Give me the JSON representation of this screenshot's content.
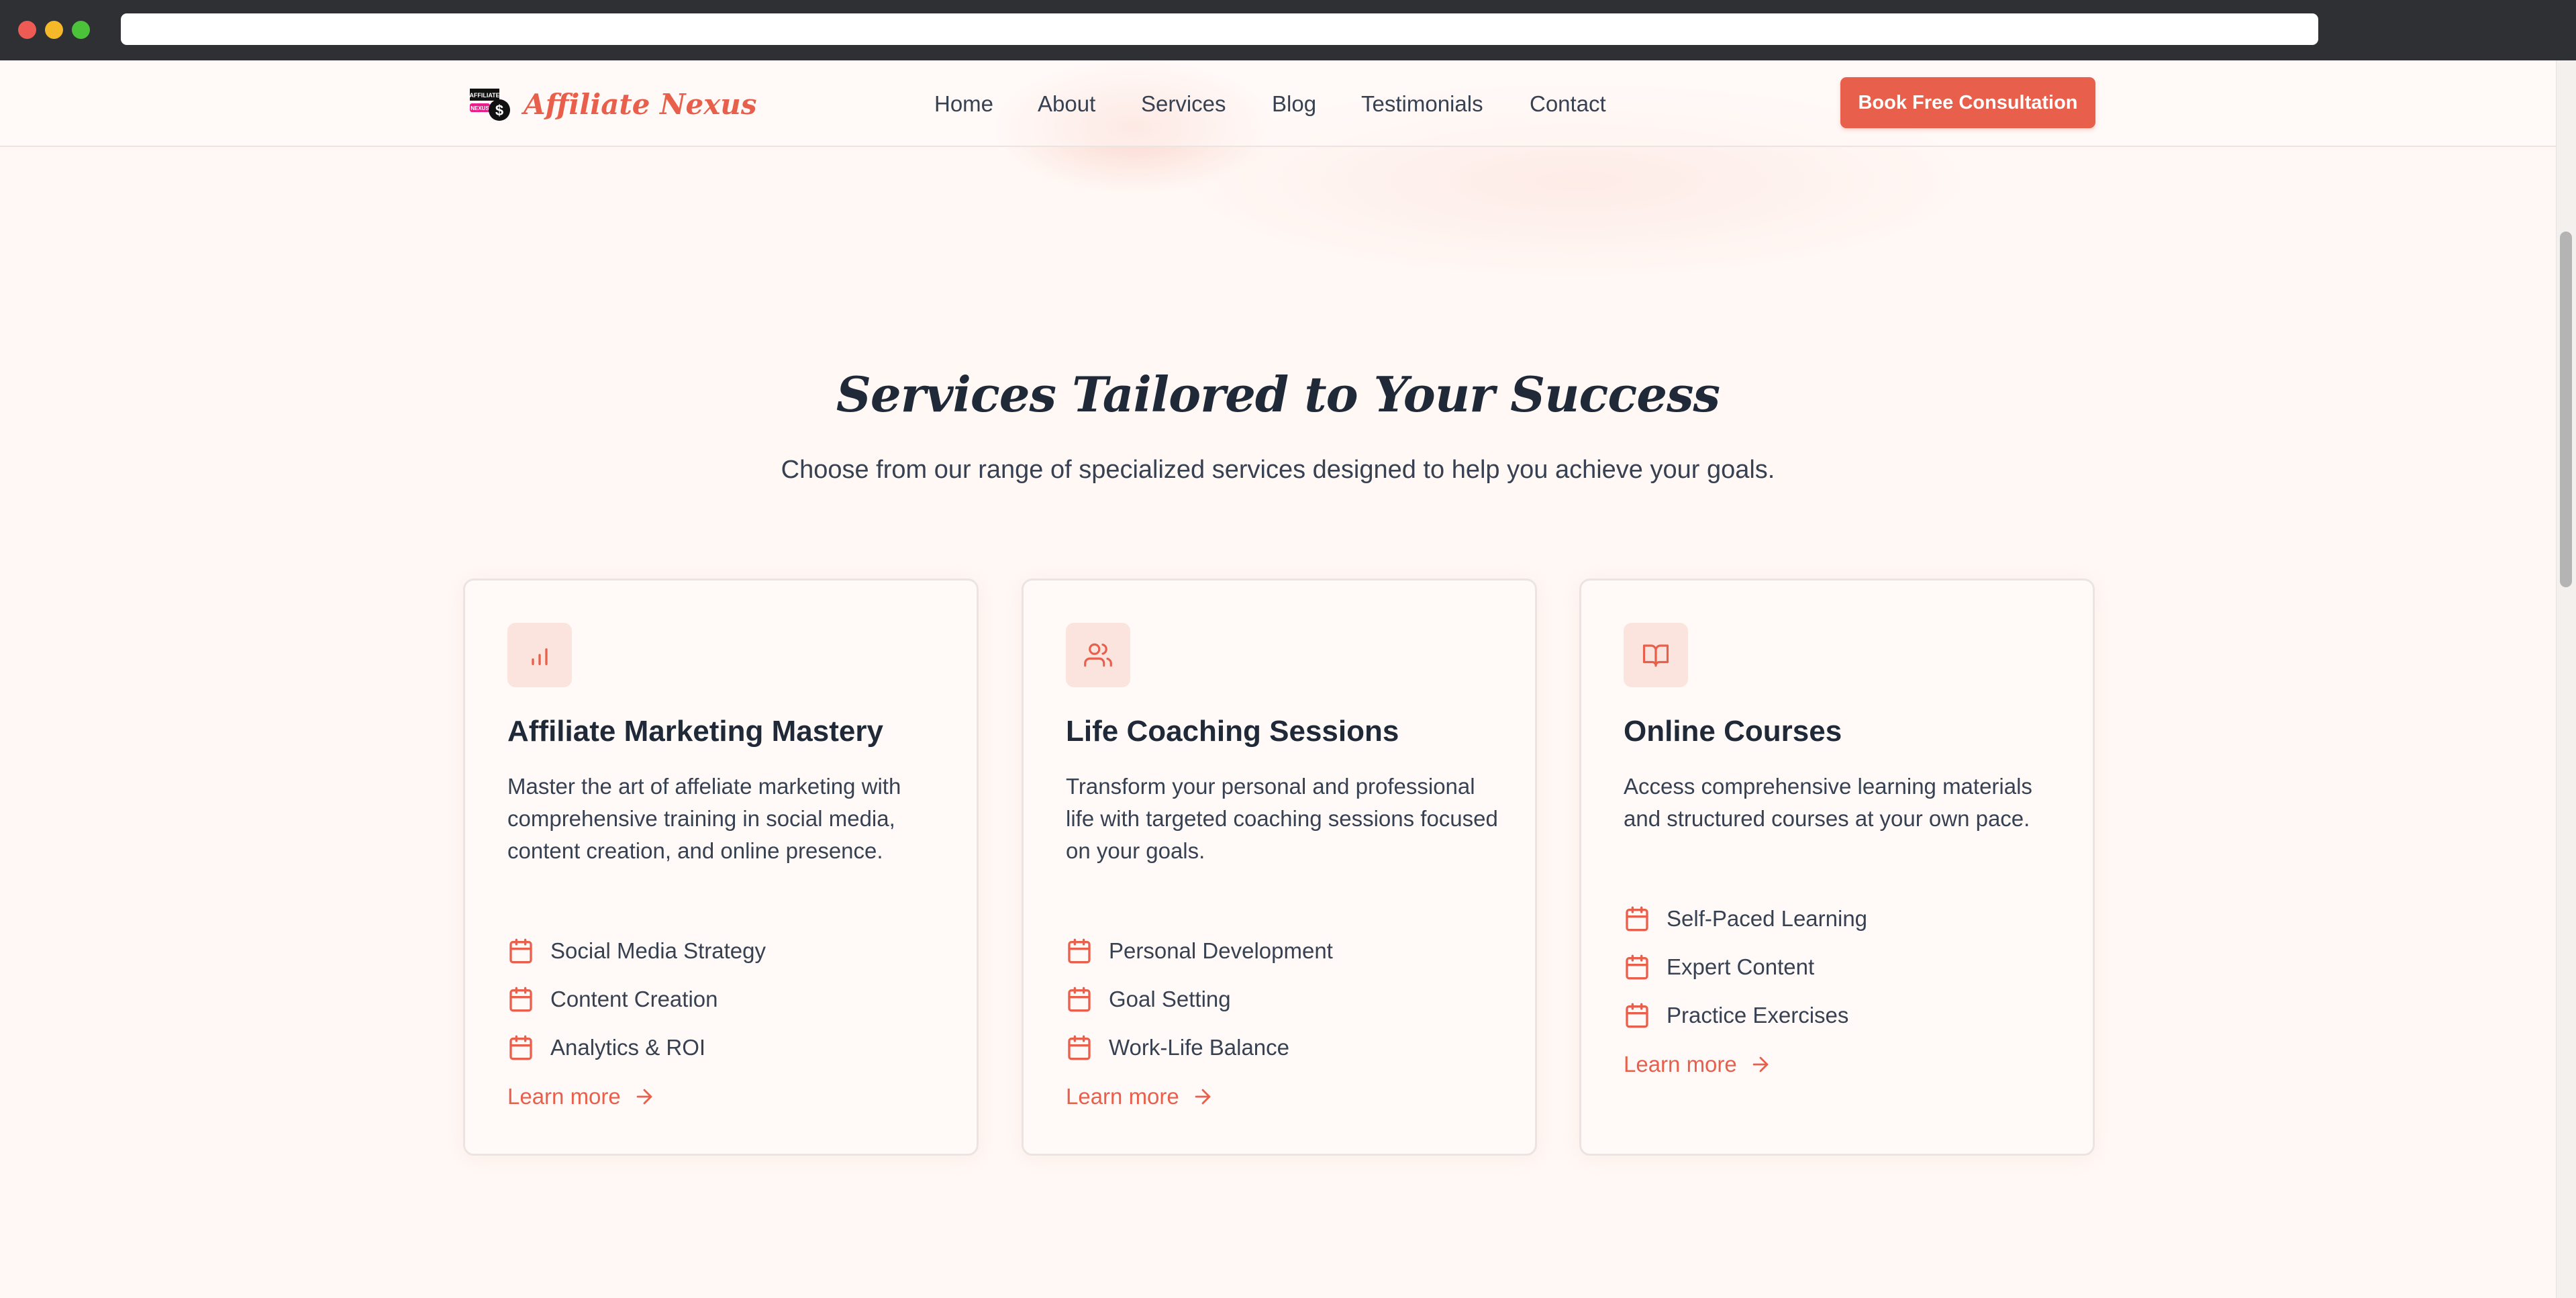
{
  "brand": {
    "name": "Affiliate Nexus",
    "logo_text": "AFFILIATE",
    "logo_badge": "NEXUS",
    "accent_color": "#e8604c"
  },
  "nav": {
    "items": [
      {
        "label": "Home"
      },
      {
        "label": "About"
      },
      {
        "label": "Services"
      },
      {
        "label": "Blog"
      },
      {
        "label": "Testimonials"
      },
      {
        "label": "Contact"
      }
    ],
    "cta_label": "Book Free Consultation"
  },
  "services": {
    "title": "Services Tailored to Your Success",
    "subtitle": "Choose from our range of specialized services designed to help you achieve your goals.",
    "cards": [
      {
        "icon": "bar-chart-icon",
        "title": "Affiliate Marketing Mastery",
        "description": "Master the art of affeliate marketing with comprehensive training in social media, content creation, and online presence.",
        "features": [
          "Social Media Strategy",
          "Content Creation",
          "Analytics & ROI"
        ],
        "link_label": "Learn more"
      },
      {
        "icon": "users-icon",
        "title": "Life Coaching Sessions",
        "description": "Transform your personal and professional life with targeted coaching sessions focused on your goals.",
        "features": [
          "Personal Development",
          "Goal Setting",
          "Work-Life Balance"
        ],
        "link_label": "Learn more"
      },
      {
        "icon": "book-open-icon",
        "title": "Online Courses",
        "description": "Access comprehensive learning materials and structured courses at your own pace.",
        "features": [
          "Self-Paced Learning",
          "Expert Content",
          "Practice Exercises"
        ],
        "link_label": "Learn more"
      }
    ]
  }
}
